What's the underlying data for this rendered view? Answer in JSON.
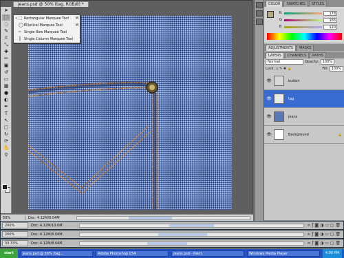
{
  "document": {
    "tab_title": "jeans.psd @ 50% (tag, RGB/8) *",
    "zoom": "50%",
    "doc_size": "Doc: 4.12M/8.04M"
  },
  "tools": [
    "arrow",
    "marquee",
    "lasso",
    "quick-select",
    "crop",
    "eyedropper",
    "healing",
    "brush",
    "stamp",
    "history-brush",
    "eraser",
    "gradient",
    "blur",
    "dodge",
    "pen",
    "type",
    "path-select",
    "shape",
    "3d-rotate",
    "3d-orbit",
    "hand",
    "zoom"
  ],
  "flyout": {
    "items": [
      {
        "label": "Rectangular Marquee Tool",
        "shortcut": "M",
        "checked": "•"
      },
      {
        "label": "Elliptical Marquee Tool",
        "shortcut": "M",
        "checked": ""
      },
      {
        "label": "Single Row Marquee Tool",
        "shortcut": "",
        "checked": ""
      },
      {
        "label": "Single Column Marquee Tool",
        "shortcut": "",
        "checked": ""
      }
    ]
  },
  "color_panel": {
    "tabs": [
      "COLOR",
      "SWATCHES",
      "STYLES"
    ],
    "fg_color": "#b5a988",
    "r_label": "R",
    "r": "178",
    "g_label": "G",
    "g": "165",
    "b_label": "B",
    "b": "120"
  },
  "adjustments_panel": {
    "tabs": [
      "ADJUSTMENTS",
      "MASKS"
    ]
  },
  "layers_panel": {
    "tabs": [
      "LAYERS",
      "CHANNELS",
      "PATHS"
    ],
    "blend_mode": "Normal",
    "opacity_label": "Opacity:",
    "opacity": "100%",
    "lock_label": "Lock:",
    "fill_label": "Fill:",
    "fill": "100%",
    "layers": [
      {
        "name": "button",
        "selected": false
      },
      {
        "name": "tag",
        "selected": true
      },
      {
        "name": "jeans",
        "selected": false
      },
      {
        "name": "Background",
        "selected": false
      }
    ]
  },
  "mini_docs": [
    {
      "zoom": "200%",
      "doc": "Doc: 4.12M/10.0M"
    },
    {
      "zoom": "200%",
      "doc": "Doc: 4.12M/8.04M"
    },
    {
      "zoom": "33.33%",
      "doc": "Doc: 4.12M/8.04M"
    }
  ],
  "taskbar": {
    "start": "start",
    "items": [
      "jeans.psd @ 50% (tag...",
      "Adobe Photoshop CS4",
      "jeans.psd - Paint",
      "Windows Media Player"
    ],
    "clock": "4:00 PM"
  }
}
